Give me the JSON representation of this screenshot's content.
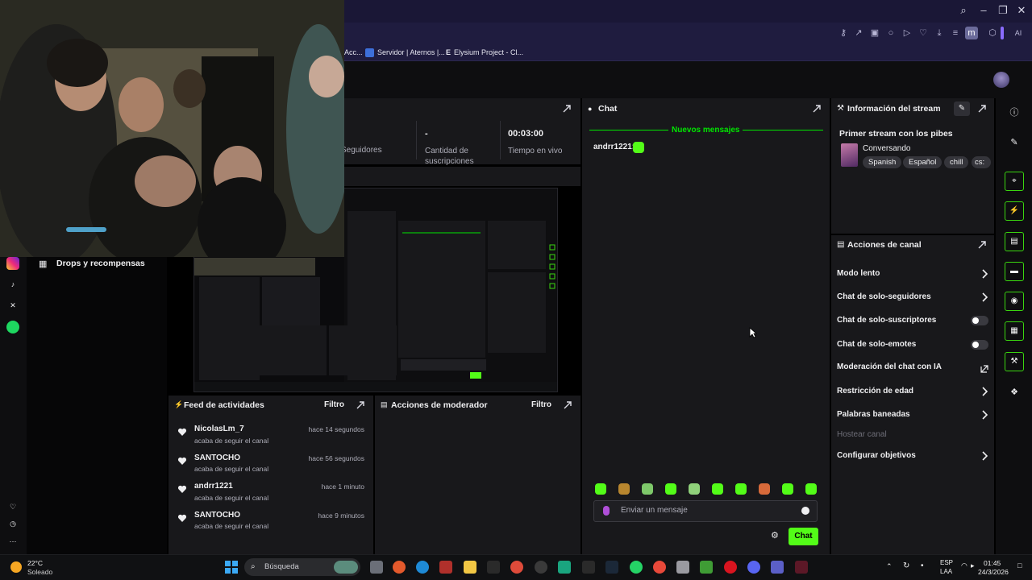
{
  "browser": {
    "bookmarks": [
      {
        "label": "Acc...",
        "color": "#2b2850"
      },
      {
        "label": "Servidor | Aternos |...",
        "color": "#3d6fd9"
      },
      {
        "label": "Elysium Project - Cl...",
        "color": "#1f1c3f",
        "prefix": "E"
      }
    ],
    "ai_label": "AI"
  },
  "stats": {
    "followers_label": "Seguidores",
    "subs_value": "-",
    "subs_label": "Cantidad de suscripciones",
    "live_value": "00:03:00",
    "live_label": "Tiempo en vivo"
  },
  "chat": {
    "title": "Chat",
    "new_messages": "Nuevos mensajes",
    "messages": [
      {
        "user": "andrr1221:"
      }
    ],
    "input_placeholder": "Enviar un mensaje",
    "send_label": "Chat"
  },
  "stream_info": {
    "title": "Información del stream",
    "stream_title": "Primer stream con los pibes",
    "category": "Conversando",
    "tags": [
      "Spanish",
      "Español",
      "chill",
      "cs:"
    ]
  },
  "channel_actions": {
    "title": "Acciones de canal",
    "items": [
      {
        "label": "Modo lento",
        "control": "chevron"
      },
      {
        "label": "Chat de solo-seguidores",
        "control": "chevron"
      },
      {
        "label": "Chat de solo-suscriptores",
        "control": "toggle",
        "on": false
      },
      {
        "label": "Chat de solo-emotes",
        "control": "toggle",
        "on": false
      },
      {
        "label": "Moderación del chat con IA",
        "control": "external"
      },
      {
        "label": "Restricción de edad",
        "control": "chevron"
      },
      {
        "label": "Palabras baneadas",
        "control": "chevron"
      },
      {
        "label": "Hostear canal",
        "control": "none",
        "disabled": true
      },
      {
        "label": "Configurar objetivos",
        "control": "chevron"
      }
    ]
  },
  "activity_feed": {
    "title": "Feed de actividades",
    "filter": "Filtro",
    "items": [
      {
        "name": "NicolasLm_7",
        "action": "acaba de seguir el canal",
        "time": "hace 14 segundos"
      },
      {
        "name": "SANTOCHO",
        "action": "acaba de seguir el canal",
        "time": "hace 56 segundos"
      },
      {
        "name": "andrr1221",
        "action": "acaba de seguir el canal",
        "time": "hace 1 minuto"
      },
      {
        "name": "SANTOCHO",
        "action": "acaba de seguir el canal",
        "time": "hace 9 minutos"
      }
    ]
  },
  "mod_actions": {
    "title": "Acciones de moderador",
    "filter": "Filtro"
  },
  "sidebar": {
    "drops": "Drops y recompensas"
  },
  "taskbar": {
    "weather_temp": "22°C",
    "weather_state": "Soleado",
    "search_placeholder": "Búsqueda",
    "lang_1": "ESP",
    "lang_2": "LAA",
    "time": "01:45",
    "date": "24/3/2026"
  },
  "colors": {
    "accent": "#53fc18",
    "panel": "#18181b",
    "background": "#000000"
  }
}
